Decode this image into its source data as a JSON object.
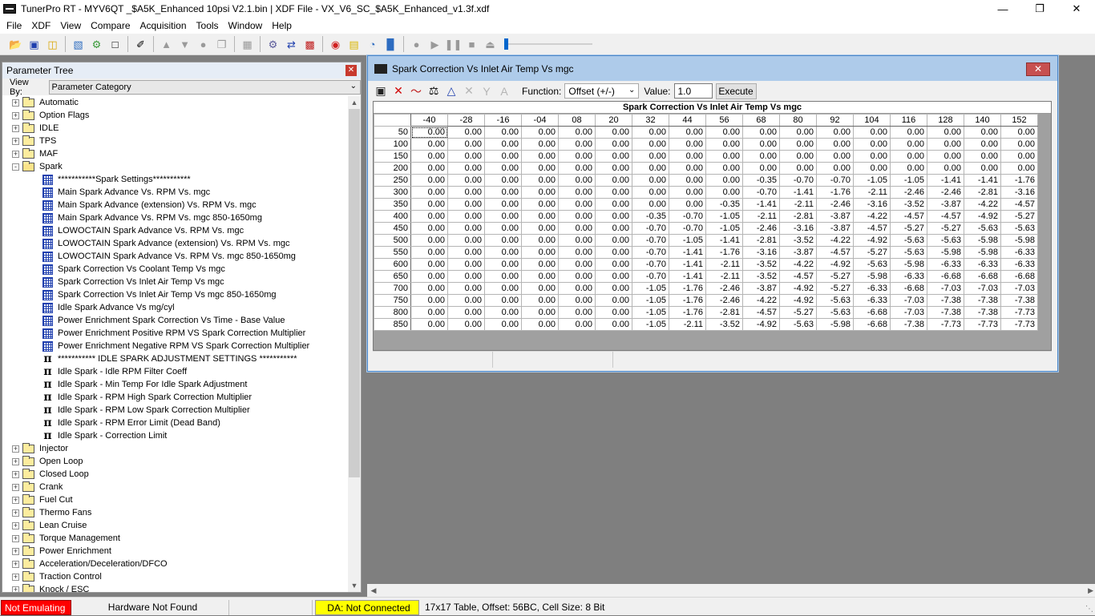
{
  "window": {
    "title": "TunerPro RT - MYV6QT  _$A5K_Enhanced 10psi V2.1.bin | XDF File - VX_V6_SC_$A5K_Enhanced_v1.3f.xdf"
  },
  "menu": [
    "File",
    "XDF",
    "View",
    "Compare",
    "Acquisition",
    "Tools",
    "Window",
    "Help"
  ],
  "tree": {
    "title": "Parameter Tree",
    "viewby_label": "View By:",
    "viewby_value": "Parameter Category",
    "nodes": [
      {
        "type": "folder",
        "expander": "+",
        "label": "Automatic"
      },
      {
        "type": "folder",
        "expander": "+",
        "label": "Option Flags"
      },
      {
        "type": "folder",
        "expander": "+",
        "label": "IDLE"
      },
      {
        "type": "folder",
        "expander": "+",
        "label": "TPS"
      },
      {
        "type": "folder",
        "expander": "+",
        "label": "MAF"
      },
      {
        "type": "folder-open",
        "expander": "-",
        "label": "Spark"
      },
      {
        "type": "table",
        "label": "***********Spark Settings***********"
      },
      {
        "type": "table",
        "label": "Main Spark Advance Vs. RPM Vs. mgc"
      },
      {
        "type": "table",
        "label": "Main Spark Advance (extension) Vs. RPM Vs. mgc"
      },
      {
        "type": "table",
        "label": "Main Spark Advance Vs. RPM Vs. mgc 850-1650mg"
      },
      {
        "type": "table",
        "label": "LOWOCTAIN Spark Advance Vs. RPM Vs. mgc"
      },
      {
        "type": "table",
        "label": "LOWOCTAIN Spark Advance (extension) Vs. RPM Vs. mgc"
      },
      {
        "type": "table",
        "label": "LOWOCTAIN Spark Advance Vs. RPM Vs. mgc 850-1650mg"
      },
      {
        "type": "table",
        "label": "Spark Correction Vs Coolant Temp Vs mgc"
      },
      {
        "type": "table",
        "label": "Spark Correction Vs Inlet Air Temp Vs mgc"
      },
      {
        "type": "table",
        "label": "Spark Correction Vs Inlet Air Temp Vs mgc 850-1650mg"
      },
      {
        "type": "table",
        "label": "Idle Spark Advance Vs mg/cyl"
      },
      {
        "type": "table",
        "label": "Power Enrichment Spark Correction Vs Time - Base Value"
      },
      {
        "type": "table",
        "label": "Power Enrichment Positive RPM VS Spark Correction Multiplier"
      },
      {
        "type": "table",
        "label": "Power Enrichment Negative RPM VS Spark Correction Multiplier"
      },
      {
        "type": "const",
        "label": "***********  IDLE SPARK ADJUSTMENT SETTINGS ***********"
      },
      {
        "type": "const",
        "label": "Idle Spark - Idle RPM Filter Coeff"
      },
      {
        "type": "const",
        "label": "Idle Spark - Min Temp For Idle Spark Adjustment"
      },
      {
        "type": "const",
        "label": "Idle Spark - RPM High Spark Correction Multiplier"
      },
      {
        "type": "const",
        "label": "Idle Spark - RPM Low Spark Correction Multiplier"
      },
      {
        "type": "const",
        "label": "Idle Spark - RPM Error Limit (Dead Band)"
      },
      {
        "type": "const",
        "label": "Idle Spark - Correction Limit"
      },
      {
        "type": "folder",
        "expander": "+",
        "label": "Injector"
      },
      {
        "type": "folder",
        "expander": "+",
        "label": "Open Loop"
      },
      {
        "type": "folder",
        "expander": "+",
        "label": "Closed Loop"
      },
      {
        "type": "folder",
        "expander": "+",
        "label": "Crank"
      },
      {
        "type": "folder",
        "expander": "+",
        "label": "Fuel Cut"
      },
      {
        "type": "folder",
        "expander": "+",
        "label": "Thermo Fans"
      },
      {
        "type": "folder",
        "expander": "+",
        "label": "Lean Cruise"
      },
      {
        "type": "folder",
        "expander": "+",
        "label": "Torque Management"
      },
      {
        "type": "folder",
        "expander": "+",
        "label": "Power Enrichment"
      },
      {
        "type": "folder",
        "expander": "+",
        "label": "Acceleration/Deceleration/DFCO"
      },
      {
        "type": "folder",
        "expander": "+",
        "label": "Traction Control"
      },
      {
        "type": "folder",
        "expander": "+",
        "label": "Knock / ESC"
      }
    ]
  },
  "table_window": {
    "title": "Spark Correction Vs Inlet Air Temp Vs mgc",
    "function_label": "Function:",
    "function_value": "Offset (+/-)",
    "value_label": "Value:",
    "value": "1.0",
    "execute_label": "Execute",
    "grid_title": "Spark Correction Vs Inlet Air Temp Vs mgc",
    "columns": [
      "-40",
      "-28",
      "-16",
      "-04",
      "08",
      "20",
      "32",
      "44",
      "56",
      "68",
      "80",
      "92",
      "104",
      "116",
      "128",
      "140",
      "152"
    ],
    "rows": [
      {
        "h": "50",
        "v": [
          "0.00",
          "0.00",
          "0.00",
          "0.00",
          "0.00",
          "0.00",
          "0.00",
          "0.00",
          "0.00",
          "0.00",
          "0.00",
          "0.00",
          "0.00",
          "0.00",
          "0.00",
          "0.00",
          "0.00"
        ]
      },
      {
        "h": "100",
        "v": [
          "0.00",
          "0.00",
          "0.00",
          "0.00",
          "0.00",
          "0.00",
          "0.00",
          "0.00",
          "0.00",
          "0.00",
          "0.00",
          "0.00",
          "0.00",
          "0.00",
          "0.00",
          "0.00",
          "0.00"
        ]
      },
      {
        "h": "150",
        "v": [
          "0.00",
          "0.00",
          "0.00",
          "0.00",
          "0.00",
          "0.00",
          "0.00",
          "0.00",
          "0.00",
          "0.00",
          "0.00",
          "0.00",
          "0.00",
          "0.00",
          "0.00",
          "0.00",
          "0.00"
        ]
      },
      {
        "h": "200",
        "v": [
          "0.00",
          "0.00",
          "0.00",
          "0.00",
          "0.00",
          "0.00",
          "0.00",
          "0.00",
          "0.00",
          "0.00",
          "0.00",
          "0.00",
          "0.00",
          "0.00",
          "0.00",
          "0.00",
          "0.00"
        ]
      },
      {
        "h": "250",
        "v": [
          "0.00",
          "0.00",
          "0.00",
          "0.00",
          "0.00",
          "0.00",
          "0.00",
          "0.00",
          "0.00",
          "-0.35",
          "-0.70",
          "-0.70",
          "-1.05",
          "-1.05",
          "-1.41",
          "-1.41",
          "-1.76"
        ]
      },
      {
        "h": "300",
        "v": [
          "0.00",
          "0.00",
          "0.00",
          "0.00",
          "0.00",
          "0.00",
          "0.00",
          "0.00",
          "0.00",
          "-0.70",
          "-1.41",
          "-1.76",
          "-2.11",
          "-2.46",
          "-2.46",
          "-2.81",
          "-3.16"
        ]
      },
      {
        "h": "350",
        "v": [
          "0.00",
          "0.00",
          "0.00",
          "0.00",
          "0.00",
          "0.00",
          "0.00",
          "0.00",
          "-0.35",
          "-1.41",
          "-2.11",
          "-2.46",
          "-3.16",
          "-3.52",
          "-3.87",
          "-4.22",
          "-4.57"
        ]
      },
      {
        "h": "400",
        "v": [
          "0.00",
          "0.00",
          "0.00",
          "0.00",
          "0.00",
          "0.00",
          "-0.35",
          "-0.70",
          "-1.05",
          "-2.11",
          "-2.81",
          "-3.87",
          "-4.22",
          "-4.57",
          "-4.57",
          "-4.92",
          "-5.27"
        ]
      },
      {
        "h": "450",
        "v": [
          "0.00",
          "0.00",
          "0.00",
          "0.00",
          "0.00",
          "0.00",
          "-0.70",
          "-0.70",
          "-1.05",
          "-2.46",
          "-3.16",
          "-3.87",
          "-4.57",
          "-5.27",
          "-5.27",
          "-5.63",
          "-5.63"
        ]
      },
      {
        "h": "500",
        "v": [
          "0.00",
          "0.00",
          "0.00",
          "0.00",
          "0.00",
          "0.00",
          "-0.70",
          "-1.05",
          "-1.41",
          "-2.81",
          "-3.52",
          "-4.22",
          "-4.92",
          "-5.63",
          "-5.63",
          "-5.98",
          "-5.98"
        ]
      },
      {
        "h": "550",
        "v": [
          "0.00",
          "0.00",
          "0.00",
          "0.00",
          "0.00",
          "0.00",
          "-0.70",
          "-1.41",
          "-1.76",
          "-3.16",
          "-3.87",
          "-4.57",
          "-5.27",
          "-5.63",
          "-5.98",
          "-5.98",
          "-6.33"
        ]
      },
      {
        "h": "600",
        "v": [
          "0.00",
          "0.00",
          "0.00",
          "0.00",
          "0.00",
          "0.00",
          "-0.70",
          "-1.41",
          "-2.11",
          "-3.52",
          "-4.22",
          "-4.92",
          "-5.63",
          "-5.98",
          "-6.33",
          "-6.33",
          "-6.33"
        ]
      },
      {
        "h": "650",
        "v": [
          "0.00",
          "0.00",
          "0.00",
          "0.00",
          "0.00",
          "0.00",
          "-0.70",
          "-1.41",
          "-2.11",
          "-3.52",
          "-4.57",
          "-5.27",
          "-5.98",
          "-6.33",
          "-6.68",
          "-6.68",
          "-6.68"
        ]
      },
      {
        "h": "700",
        "v": [
          "0.00",
          "0.00",
          "0.00",
          "0.00",
          "0.00",
          "0.00",
          "-1.05",
          "-1.76",
          "-2.46",
          "-3.87",
          "-4.92",
          "-5.27",
          "-6.33",
          "-6.68",
          "-7.03",
          "-7.03",
          "-7.03"
        ]
      },
      {
        "h": "750",
        "v": [
          "0.00",
          "0.00",
          "0.00",
          "0.00",
          "0.00",
          "0.00",
          "-1.05",
          "-1.76",
          "-2.46",
          "-4.22",
          "-4.92",
          "-5.63",
          "-6.33",
          "-7.03",
          "-7.38",
          "-7.38",
          "-7.38"
        ]
      },
      {
        "h": "800",
        "v": [
          "0.00",
          "0.00",
          "0.00",
          "0.00",
          "0.00",
          "0.00",
          "-1.05",
          "-1.76",
          "-2.81",
          "-4.57",
          "-5.27",
          "-5.63",
          "-6.68",
          "-7.03",
          "-7.38",
          "-7.38",
          "-7.73"
        ]
      },
      {
        "h": "850",
        "v": [
          "0.00",
          "0.00",
          "0.00",
          "0.00",
          "0.00",
          "0.00",
          "-1.05",
          "-2.11",
          "-3.52",
          "-4.92",
          "-5.63",
          "-5.98",
          "-6.68",
          "-7.38",
          "-7.73",
          "-7.73",
          "-7.73"
        ]
      }
    ]
  },
  "status": {
    "emulation": "Not Emulating",
    "hardware": "Hardware Not Found",
    "da": "DA: Not Connected",
    "info": "17x17 Table, Offset: 56BC,  Cell Size: 8 Bit"
  },
  "colors": {
    "emulation_bg": "#ff0000",
    "da_bg": "#ffff00",
    "window_title_bg": "#aecbea"
  }
}
